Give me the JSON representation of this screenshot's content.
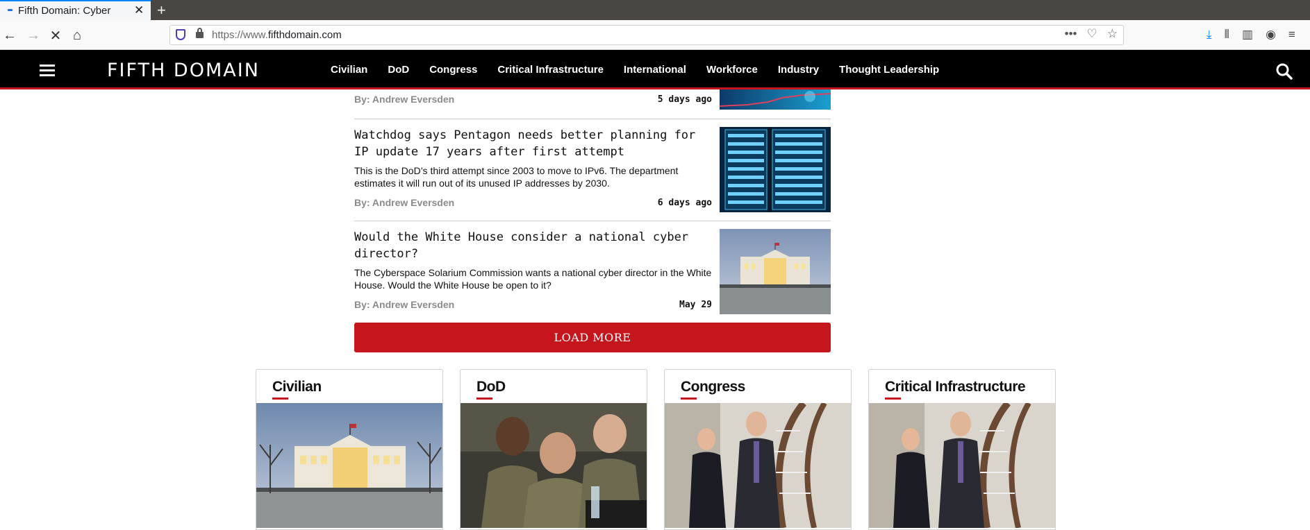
{
  "browser": {
    "tab_title": "Fifth Domain: Cyber",
    "tab_close": "✕",
    "new_tab": "+",
    "url_prefix": "https://www.",
    "url_host": "fifthdomain.com",
    "back_icon": "←",
    "forward_icon": "→",
    "stop_icon": "✕",
    "home_icon": "⌂",
    "page_actions_icon": "•••",
    "pocket_icon": "♡",
    "bookmark_icon": "☆",
    "download_icon": "⤓",
    "library_icon": "⦀",
    "sidebar_icon": "▥",
    "account_icon": "◉",
    "menu_icon": "≡"
  },
  "site": {
    "logo": "FIFTH DOMAIN",
    "nav": [
      "Civilian",
      "DoD",
      "Congress",
      "Critical Infrastructure",
      "International",
      "Workforce",
      "Industry",
      "Thought Leadership"
    ],
    "brand_color": "#c4161c"
  },
  "articles": [
    {
      "byline": "By: Andrew Eversden",
      "date": "5 days ago"
    },
    {
      "headline": "Watchdog says Pentagon needs better planning for IP update 17 years after first attempt",
      "dek": "This is the DoD’s third attempt since 2003 to move to IPv6. The department estimates it will run out of its unused IP addresses by 2030.",
      "byline": "By: Andrew Eversden",
      "date": "6 days ago"
    },
    {
      "headline": "Would the White House consider a national cyber director?",
      "dek": "The Cyberspace Solarium Commission wants a national cyber director in the White House. Would the White House be open to it?",
      "byline": "By: Andrew Eversden",
      "date": "May 29"
    }
  ],
  "load_more": "LOAD MORE",
  "categories": [
    {
      "title": "Civilian",
      "image": "white-house"
    },
    {
      "title": "DoD",
      "image": "soldiers-at-computers"
    },
    {
      "title": "Congress",
      "image": "officials-on-staircase"
    },
    {
      "title": "Critical Infrastructure",
      "image": "officials-on-staircase"
    }
  ]
}
